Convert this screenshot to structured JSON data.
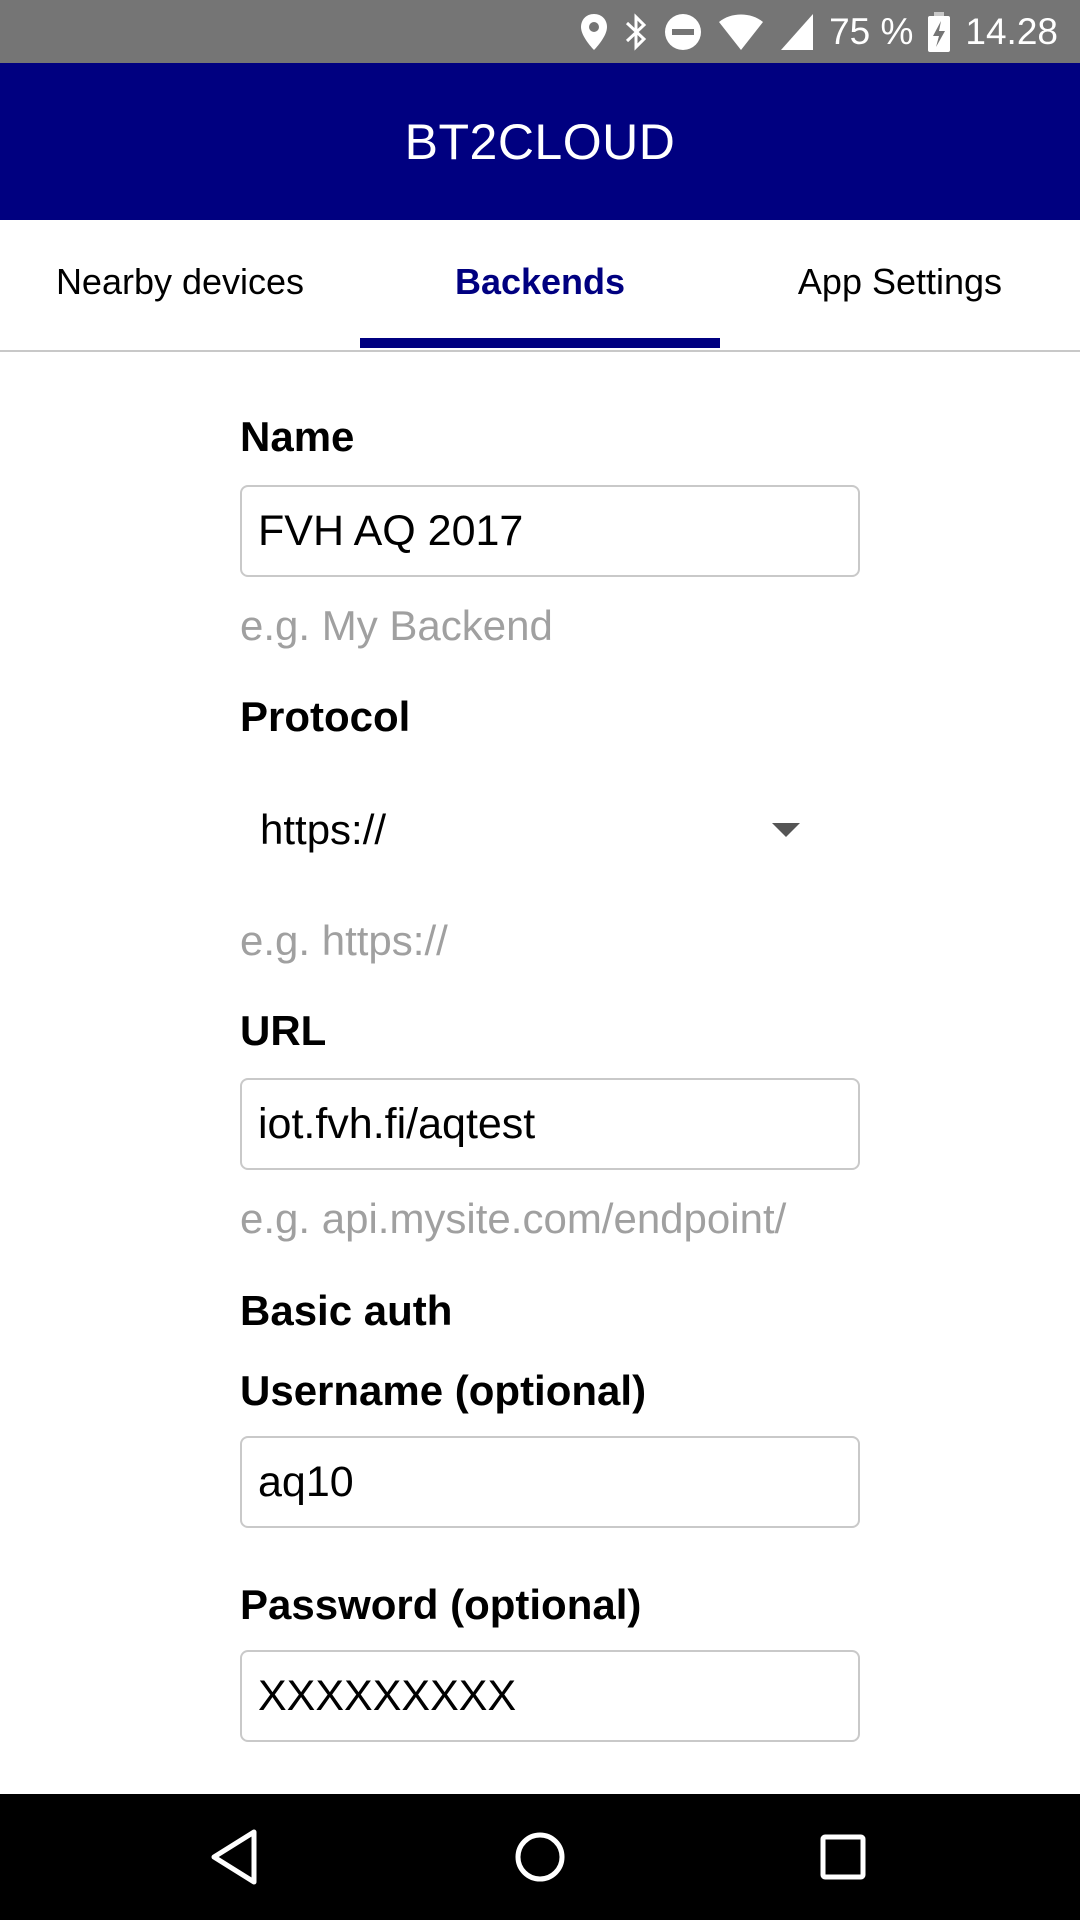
{
  "status_bar": {
    "battery_percent": "75 %",
    "time": "14.28",
    "icons": [
      "location-icon",
      "bluetooth-icon",
      "do-not-disturb-icon",
      "wifi-icon",
      "cellular-signal-icon",
      "battery-charging-icon"
    ]
  },
  "app_bar": {
    "title": "BT2CLOUD",
    "color": "#000080"
  },
  "tabs": [
    {
      "label": "Nearby devices",
      "active": false
    },
    {
      "label": "Backends",
      "active": true
    },
    {
      "label": "App Settings",
      "active": false
    }
  ],
  "form": {
    "name": {
      "label": "Name",
      "value": "FVH AQ 2017",
      "hint": "e.g. My Backend"
    },
    "protocol": {
      "label": "Protocol",
      "value": "https://",
      "hint": "e.g. https://"
    },
    "url": {
      "label": "URL",
      "value": "iot.fvh.fi/aqtest",
      "hint": "e.g. api.mysite.com/endpoint/"
    },
    "basic_auth": {
      "heading": "Basic auth",
      "username": {
        "label": "Username (optional)",
        "value": "aq10"
      },
      "password": {
        "label": "Password (optional)",
        "value": "XXXXXXXXX"
      }
    }
  },
  "nav_bar": {
    "buttons": [
      "back-icon",
      "home-icon",
      "recents-icon"
    ]
  }
}
